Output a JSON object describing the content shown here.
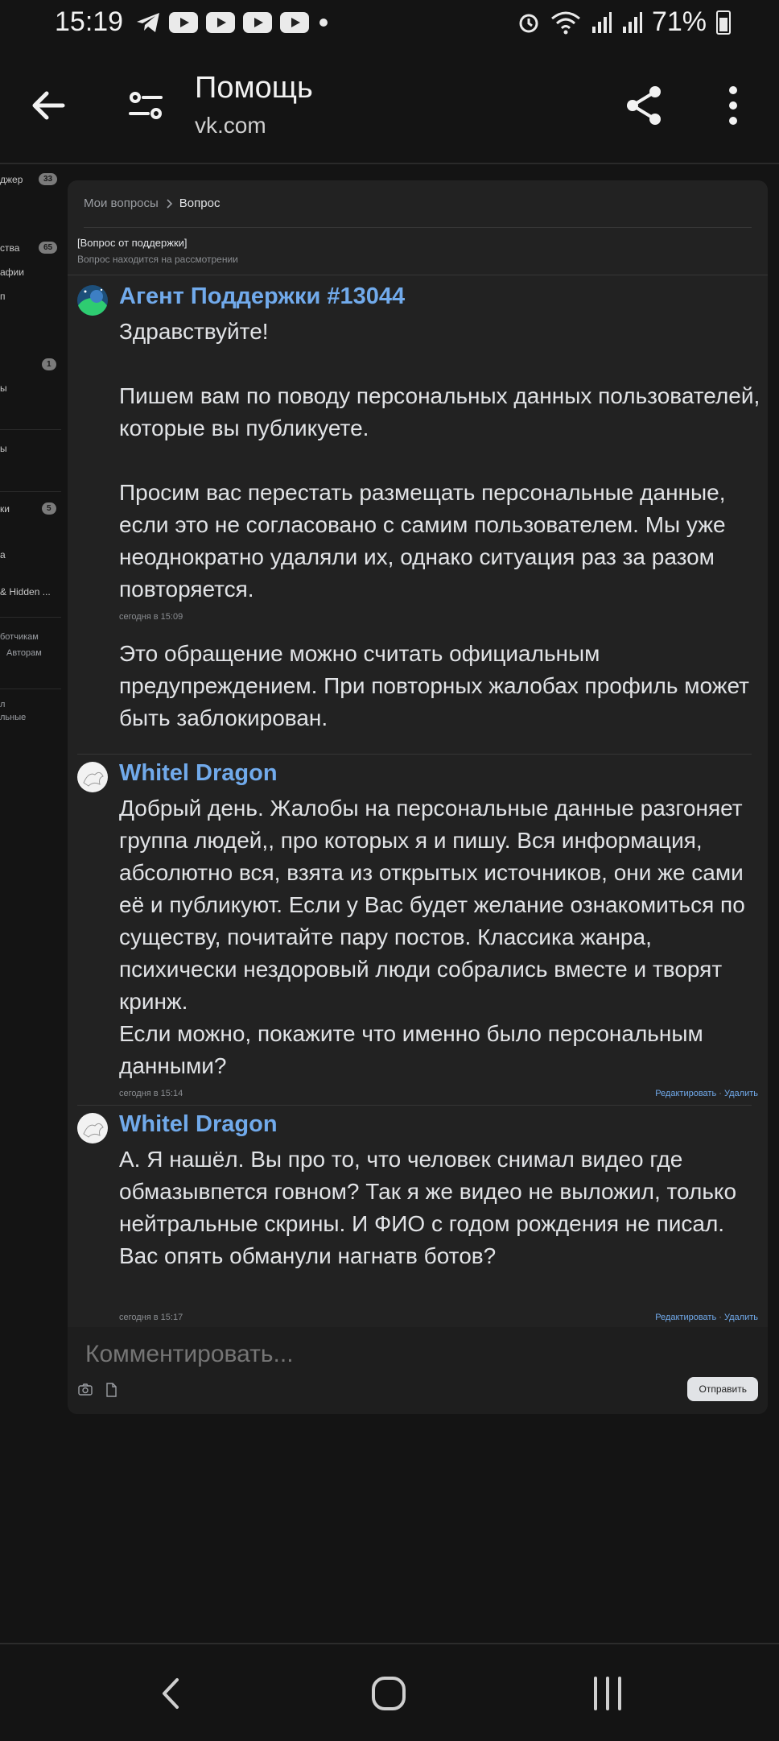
{
  "status_bar": {
    "time": "15:19",
    "battery": "71%",
    "icons": [
      "telegram-icon",
      "youtube-icon",
      "youtube-icon",
      "youtube-icon",
      "youtube-icon",
      "dot-icon",
      "alarm-icon",
      "wifi-icon",
      "signal-icon",
      "signal-icon",
      "battery-icon"
    ]
  },
  "app_bar": {
    "title": "Помощь",
    "subtitle": "vk.com"
  },
  "sidebar": {
    "items": [
      {
        "label": "джер",
        "badge": "33"
      },
      {
        "label": "ства",
        "badge": "65"
      },
      {
        "label": "афии"
      },
      {
        "label": "п"
      },
      {
        "badge": "1"
      },
      {
        "label": "ы"
      },
      {
        "label": "ы"
      },
      {
        "label": "ки",
        "badge": "5"
      },
      {
        "label": "а"
      },
      {
        "label": "& Hidden ..."
      },
      {
        "label": "ботчикам"
      },
      {
        "label": "Авторам"
      },
      {
        "label": "л"
      },
      {
        "label": "льные"
      }
    ]
  },
  "breadcrumbs": {
    "parent": "Мои вопросы",
    "current": "Вопрос"
  },
  "question": {
    "title": "[Вопрос от поддержки]",
    "status": "Вопрос находится на рассмотрении"
  },
  "messages": [
    {
      "author": "Агент Поддержки #13044",
      "text": "Здравствуйте!\n\nПишем вам по поводу персональных данных пользователей, которые вы публикуете.\n\nПросим вас перестать размещать персональные данные, если это не согласовано с самим пользователем. Мы уже неоднократно удаляли их, однако ситуация раз за разом повторяется.\n\nЭто обращение можно считать официальным предупреждением. При повторных жалобах профиль может быть заблокирован.",
      "time": "сегодня в 15:09"
    },
    {
      "author": "Whitel Dragon",
      "text": "Добрый день. Жалобы на персональные данные разгоняет группа людей,, про которых я и пишу. Вся информация, абсолютно вся, взята из открытых источников, они же сами её и публикуют. Если у Вас будет желание ознакомиться по существу, почитайте пару постов. Классика жанра, психически нездоровый люди собрались вместе и творят кринж.\nЕсли можно, покажите что именно было персональным данными?",
      "time": "сегодня в 15:14",
      "edit": "Редактировать",
      "delete": "Удалить"
    },
    {
      "author": "Whitel Dragon",
      "text": "А. Я нашёл. Вы про то, что человек снимал видео где обмазывпется говном? Так я же видео не выложил, только нейтральные скрины. И ФИО с годом рождения не писал. Вас опять обманули нагнатв ботов?",
      "time": "сегодня в 15:17",
      "edit": "Редактировать",
      "delete": "Удалить"
    }
  ],
  "comment": {
    "placeholder": "Комментировать...",
    "send_label": "Отправить"
  },
  "colors": {
    "background": "#141414",
    "card": "#222222",
    "link": "#71aaeb",
    "text": "#e1e3e6"
  }
}
